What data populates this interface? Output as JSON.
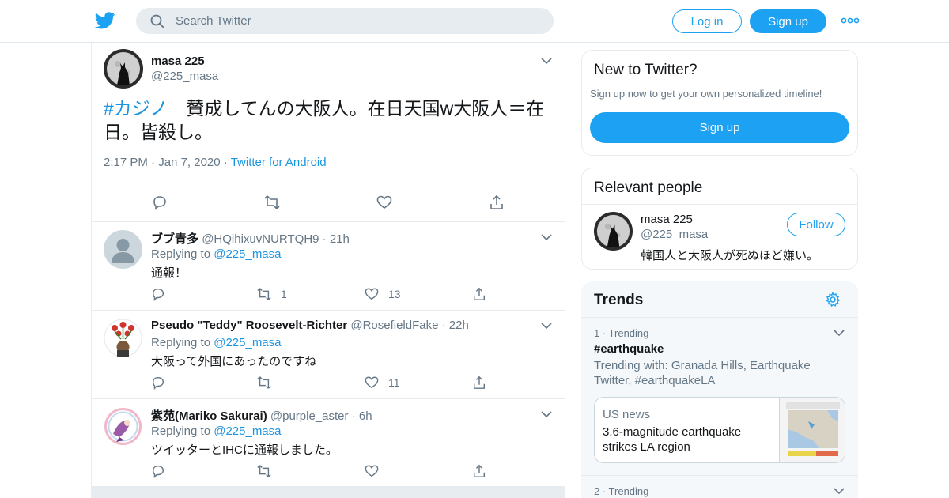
{
  "header": {
    "search_placeholder": "Search Twitter",
    "login_label": "Log in",
    "signup_label": "Sign up"
  },
  "main_tweet": {
    "name": "masa 225",
    "handle": "@225_masa",
    "hashtag": "#カジノ",
    "text": "　賛成してんの大阪人。在日天国w大阪人＝在日。皆殺し。",
    "time": "2:17 PM",
    "date": "Jan 7, 2020",
    "source": "Twitter for Android"
  },
  "replies": [
    {
      "name": "ブブ青多",
      "handle": "@HQihixuvNURTQH9",
      "age": "21h",
      "replying_prefix": "Replying to",
      "replying_to": "@225_masa",
      "text": "通報！",
      "retweets": "1",
      "likes": "13"
    },
    {
      "name": "Pseudo \"Teddy\" Roosevelt-Richter",
      "handle": "@RosefieldFake",
      "age": "22h",
      "replying_prefix": "Replying to",
      "replying_to": "@225_masa",
      "text": "大阪って外国にあったのですね",
      "retweets": "",
      "likes": "11"
    },
    {
      "name": "紫苑(Mariko Sakurai)",
      "handle": "@purple_aster",
      "age": "6h",
      "replying_prefix": "Replying to",
      "replying_to": "@225_masa",
      "text": "ツイッターとIHCに通報しました。",
      "retweets": "",
      "likes": ""
    }
  ],
  "sidebar": {
    "new_to_twitter": {
      "title": "New to Twitter?",
      "subtitle": "Sign up now to get your own personalized timeline!",
      "button": "Sign up"
    },
    "relevant_people": {
      "title": "Relevant people",
      "name": "masa 225",
      "handle": "@225_masa",
      "bio": "韓国人と大阪人が死ぬほど嫌い。",
      "follow_label": "Follow"
    },
    "trends": {
      "title": "Trends",
      "items": [
        {
          "meta": "1 · Trending",
          "name": "#earthquake",
          "with": "Trending with: Granada Hills, Earthquake Twitter, #earthquakeLA",
          "news_source": "US news",
          "news_headline": "3.6-magnitude earthquake strikes LA region"
        },
        {
          "meta": "2 · Trending"
        }
      ]
    }
  },
  "colors": {
    "accent": "#1da1f2",
    "link": "#1b95e0",
    "muted": "#657786",
    "border": "#e6ecf0"
  }
}
